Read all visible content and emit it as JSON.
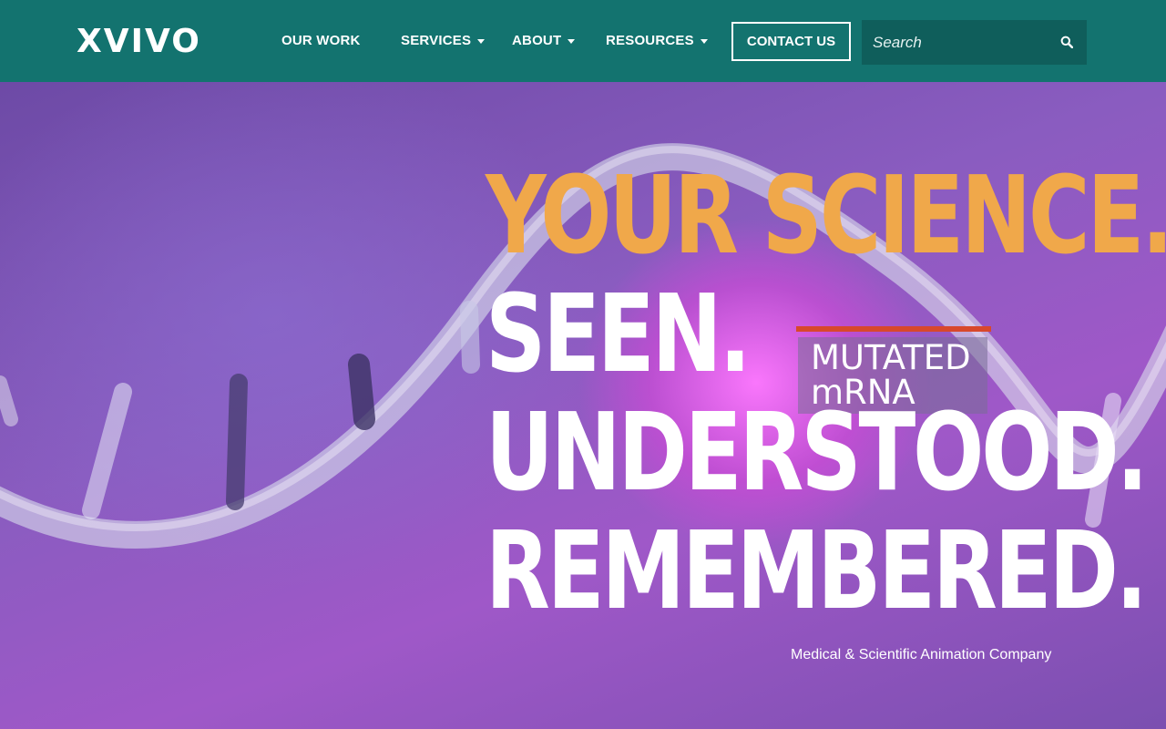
{
  "header": {
    "logo": "XVIVO",
    "nav": [
      {
        "label": "OUR WORK",
        "has_dropdown": false
      },
      {
        "label": "SERVICES",
        "has_dropdown": true
      },
      {
        "label": "ABOUT",
        "has_dropdown": true
      },
      {
        "label": "RESOURCES",
        "has_dropdown": true
      }
    ],
    "contact_label": "CONTACT US",
    "search": {
      "placeholder": "Search",
      "value": "",
      "icon": "search-icon"
    }
  },
  "hero": {
    "line1": "YOUR SCIENCE.",
    "line2": "SEEN.",
    "line3": "UNDERSTOOD.",
    "line4": "REMEMBERED.",
    "tag_line1": "MUTATED",
    "tag_line2": "mRNA",
    "subtitle": "Medical & Scientific Animation Company"
  },
  "colors": {
    "header_bg": "#13736f",
    "headline_accent": "#f0a84a",
    "tag_bar": "#d8482c"
  }
}
